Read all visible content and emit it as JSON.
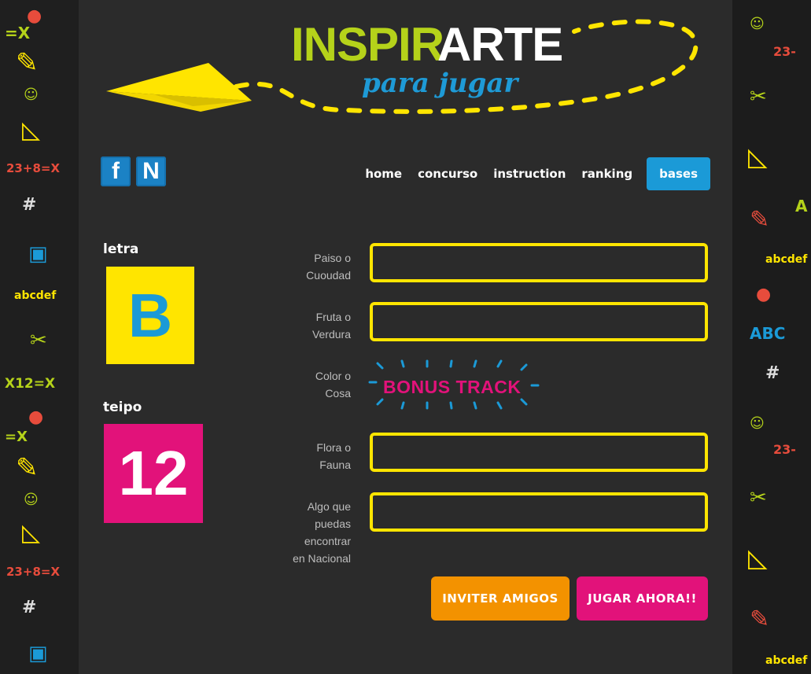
{
  "header": {
    "logo_part1": "INSPIR",
    "logo_part2": "ARTE",
    "logo_sub": "para jugar"
  },
  "social": {
    "facebook_label": "f",
    "n_label": "N"
  },
  "nav": {
    "items": [
      "home",
      "concurso",
      "instruction",
      "ranking",
      "bases"
    ],
    "active": "bases"
  },
  "left": {
    "letter_label": "letra",
    "letter_value": "B",
    "time_label": "teipo",
    "time_value": "12"
  },
  "form": {
    "fields": [
      {
        "label_line1": "Paiso o",
        "label_line2": "Cuoudad",
        "value": ""
      },
      {
        "label_line1": "Fruta o",
        "label_line2": "Verdura",
        "value": ""
      },
      {
        "label_line1": "Color o",
        "label_line2": "Cosa",
        "value": ""
      },
      {
        "label_line1": "Flora o",
        "label_line2": "Fauna",
        "value": ""
      },
      {
        "label_line1": "Algo que",
        "label_line2": "puedas",
        "label_line3": "encontrar",
        "label_line4": "en Nacional",
        "value": ""
      }
    ],
    "bonus_text": "BONUS TRACK"
  },
  "buttons": {
    "invite": "INVITER AMIGOS",
    "play": "JUGAR AHORA!!"
  },
  "doodles": {
    "left": [
      "=X",
      "23+8=X",
      "abcdef",
      "X12=X",
      "=X",
      "23+8=X"
    ],
    "right": [
      "23-",
      "abcdef",
      "ABC",
      "A",
      "23-",
      "abcdef"
    ]
  },
  "colors": {
    "yellow": "#ffe500",
    "pink": "#e2127a",
    "blue": "#1b9ad7",
    "green": "#b5d21a",
    "orange": "#f39200"
  }
}
